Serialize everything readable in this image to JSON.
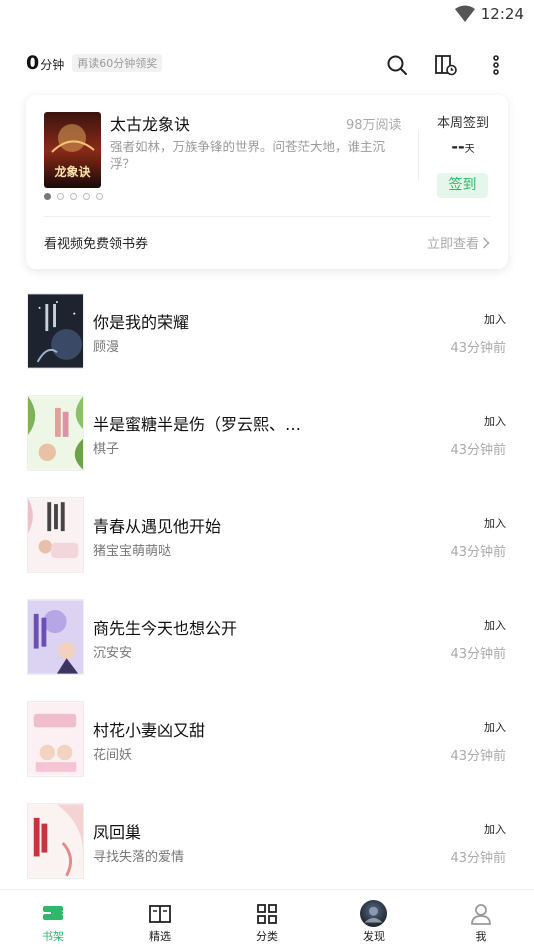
{
  "status_bar": {
    "time": "12:24"
  },
  "header": {
    "reading_minutes": "0",
    "minutes_unit": "分钟",
    "reward_tip": "再读60分钟领奖",
    "icons": [
      "search-icon",
      "bookshelf-history-icon",
      "more-icon"
    ]
  },
  "featured": {
    "title": "太古龙象诀",
    "reads": "98万阅读",
    "description": "强者如林，万族争锋的世界。问苍茫大地，谁主沉浮？",
    "cover_text": "龙象诀",
    "checkin_label": "本周签到",
    "checkin_days": "--",
    "checkin_days_unit": "天",
    "checkin_button": "签到",
    "promo_text": "看视频免费领书券",
    "promo_link": "立即查看",
    "carousel_count": 5,
    "carousel_active": 0
  },
  "books": [
    {
      "title": "你是我的荣耀",
      "author": "顾漫",
      "action": "加入",
      "time": "43分钟前",
      "cover_bg": "#20242c",
      "cover_accent": "#8aa0b8"
    },
    {
      "title": "半是蜜糖半是伤（罗云熙、…",
      "author": "棋子",
      "action": "加入",
      "time": "43分钟前",
      "cover_bg": "#eaf3df",
      "cover_accent": "#7fb05a"
    },
    {
      "title": "青春从遇见他开始",
      "author": "猪宝宝萌萌哒",
      "action": "加入",
      "time": "43分钟前",
      "cover_bg": "#f7eef0",
      "cover_accent": "#d99aa8"
    },
    {
      "title": "商先生今天也想公开",
      "author": "沉安安",
      "action": "加入",
      "time": "43分钟前",
      "cover_bg": "#d8d0f0",
      "cover_accent": "#7c64c0"
    },
    {
      "title": "村花小妻凶又甜",
      "author": "花间妖",
      "action": "加入",
      "time": "43分钟前",
      "cover_bg": "#fbeef2",
      "cover_accent": "#e58aa5"
    },
    {
      "title": "凤回巢",
      "author": "寻找失落的爱情",
      "action": "加入",
      "time": "43分钟前",
      "cover_bg": "#fbf1ef",
      "cover_accent": "#c9333f"
    }
  ],
  "bottom_nav": [
    {
      "label": "书架",
      "icon": "bookshelf-icon",
      "active": true
    },
    {
      "label": "精选",
      "icon": "open-book-icon",
      "active": false
    },
    {
      "label": "分类",
      "icon": "category-grid-icon",
      "active": false
    },
    {
      "label": "发现",
      "icon": "discover-avatar-icon",
      "active": false
    },
    {
      "label": "我",
      "icon": "profile-icon",
      "active": false
    }
  ],
  "colors": {
    "accent": "#2fb86a",
    "checkin_bg": "#e5f7ea"
  }
}
